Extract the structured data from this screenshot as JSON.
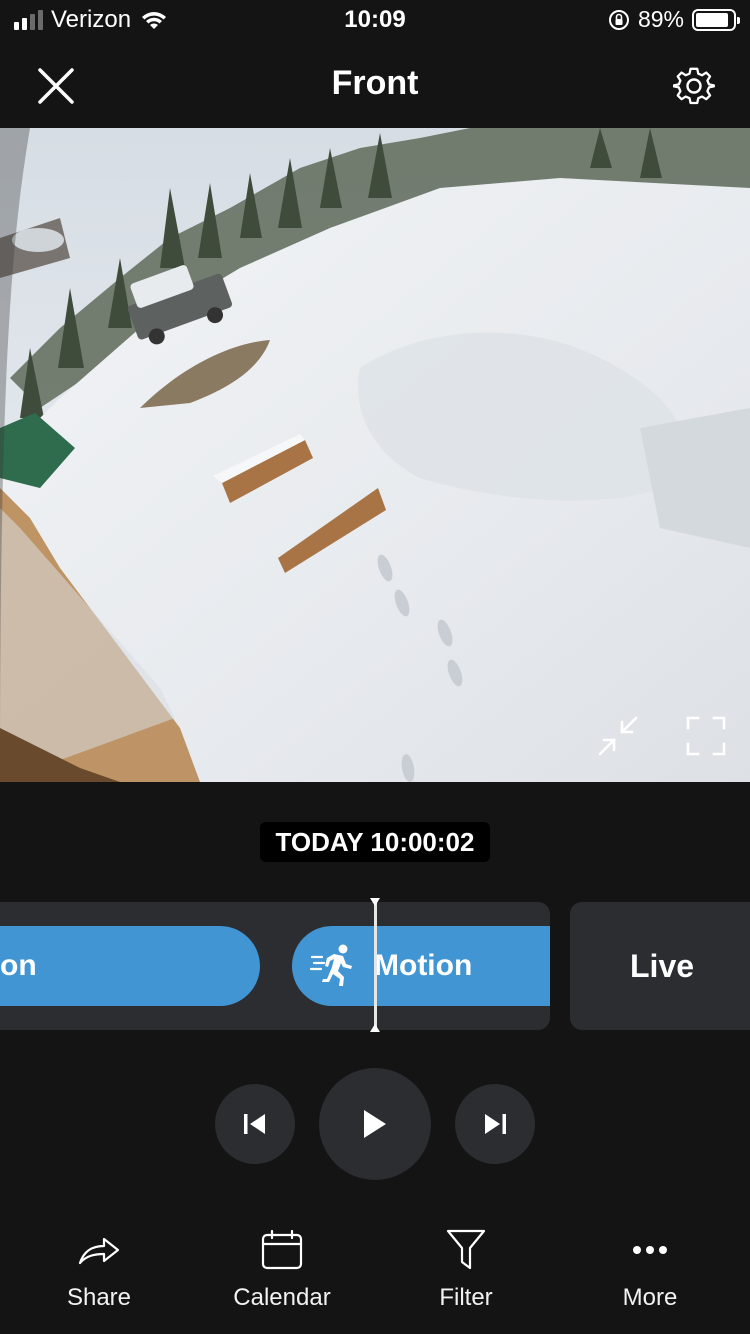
{
  "status_bar": {
    "carrier": "Verizon",
    "time": "10:09",
    "battery_percent": "89%",
    "battery_level": 0.89,
    "signal_bars_active": 2,
    "signal_bars_total": 4
  },
  "nav": {
    "title": "Front",
    "close_icon": "close-icon",
    "settings_icon": "gear-icon"
  },
  "video": {
    "controls": [
      "collapse-icon",
      "fullscreen-icon"
    ]
  },
  "timestamp": "TODAY 10:00:02",
  "timeline": {
    "previous_event_label": "on",
    "current_event_label": "Motion",
    "current_event_icon": "running-person-icon",
    "live_label": "Live",
    "event_color": "#4195d3"
  },
  "playback": {
    "prev_icon": "skip-previous-icon",
    "play_icon": "play-icon",
    "next_icon": "skip-next-icon"
  },
  "toolbar": {
    "items": [
      {
        "label": "Share",
        "icon": "share-icon"
      },
      {
        "label": "Calendar",
        "icon": "calendar-icon"
      },
      {
        "label": "Filter",
        "icon": "filter-icon"
      },
      {
        "label": "More",
        "icon": "more-icon"
      }
    ]
  }
}
